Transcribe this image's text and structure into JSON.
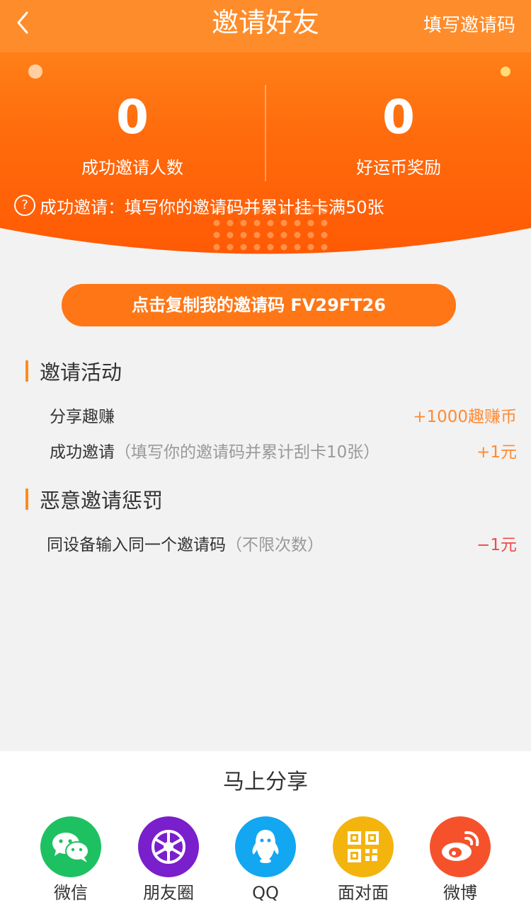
{
  "header": {
    "back_icon": "chevron-left-icon",
    "title": "邀请好友",
    "fill_code_label": "填写邀请码"
  },
  "stats": {
    "invite_count": "0",
    "invite_count_label": "成功邀请人数",
    "coin_reward": "0",
    "coin_reward_label": "好运币奖励"
  },
  "hero_note": {
    "icon": "question-circle-icon",
    "text": "成功邀请：填写你的邀请码并累计挂卡满50张"
  },
  "copy_button": {
    "label": "点击复制我的邀请码 FV29FT26"
  },
  "invite_activity": {
    "title": "邀请活动",
    "rows": [
      {
        "label": "分享趣赚",
        "note": "",
        "value": "+1000趣赚币"
      },
      {
        "label": "成功邀请",
        "note": "（填写你的邀请码并累计刮卡10张）",
        "value": "+1元"
      }
    ]
  },
  "penalty": {
    "title": "恶意邀请惩罚",
    "rows": [
      {
        "label": "同设备输入同一个邀请码",
        "note": "（不限次数）",
        "value": "−1元"
      }
    ]
  },
  "share": {
    "title": "马上分享",
    "items": [
      {
        "label": "微信",
        "icon": "wechat-icon",
        "color": "#1ec162"
      },
      {
        "label": "朋友圈",
        "icon": "moments-icon",
        "color": "#7a1fcc"
      },
      {
        "label": "QQ",
        "icon": "qq-icon",
        "color": "#12a7f0"
      },
      {
        "label": "面对面",
        "icon": "qr-code-icon",
        "color": "#f4b40e"
      },
      {
        "label": "微博",
        "icon": "weibo-icon",
        "color": "#f5522c"
      }
    ]
  },
  "colors": {
    "header": "#ff8c2a",
    "hero_top": "#ff8c1f",
    "hero_bottom": "#ff5a05",
    "accent": "#fe7615",
    "reward": "#ff8a33",
    "penalty": "#ef4a4a"
  }
}
